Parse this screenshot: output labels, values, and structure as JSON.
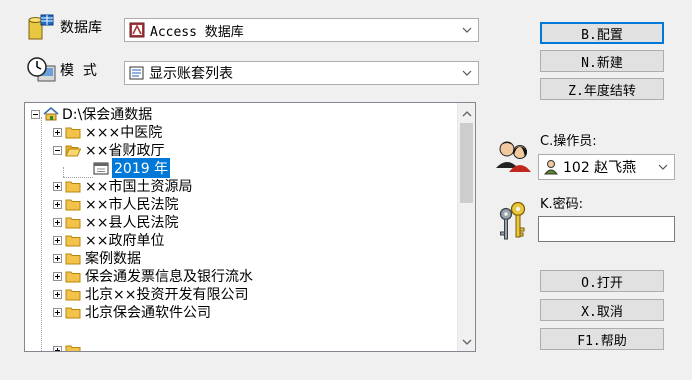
{
  "database": {
    "label": "数据库",
    "value": "Access 数据库"
  },
  "mode": {
    "label": "模  式",
    "value": "显示账套列表"
  },
  "buttons": {
    "config": "B.配置",
    "new": "N.新建",
    "year_end": "Z.年度结转",
    "open": "O.打开",
    "cancel": "X.取消",
    "help": "F1.帮助"
  },
  "operator": {
    "label": "C.操作员:",
    "value": "102 赵飞燕"
  },
  "password": {
    "label": "K.密码:",
    "value": ""
  },
  "tree": {
    "root": "D:\\保会通数据",
    "items": [
      {
        "label": "×××中医院",
        "state": "collapsed"
      },
      {
        "label": "××省财政厅",
        "state": "expanded"
      },
      {
        "label": "2019 年",
        "state": "selected-child"
      },
      {
        "label": "××市国土资源局",
        "state": "collapsed"
      },
      {
        "label": "××市人民法院",
        "state": "collapsed"
      },
      {
        "label": "××县人民法院",
        "state": "collapsed"
      },
      {
        "label": "××政府单位",
        "state": "collapsed"
      },
      {
        "label": "案例数据",
        "state": "collapsed"
      },
      {
        "label": "保会通发票信息及银行流水",
        "state": "collapsed"
      },
      {
        "label": "北京××投资开发有限公司",
        "state": "collapsed"
      },
      {
        "label": "北京保会通软件公司",
        "state": "collapsed"
      }
    ]
  },
  "colors": {
    "accent": "#0078d7",
    "folder": "#f3c24a",
    "background": "#f0f0f0"
  }
}
